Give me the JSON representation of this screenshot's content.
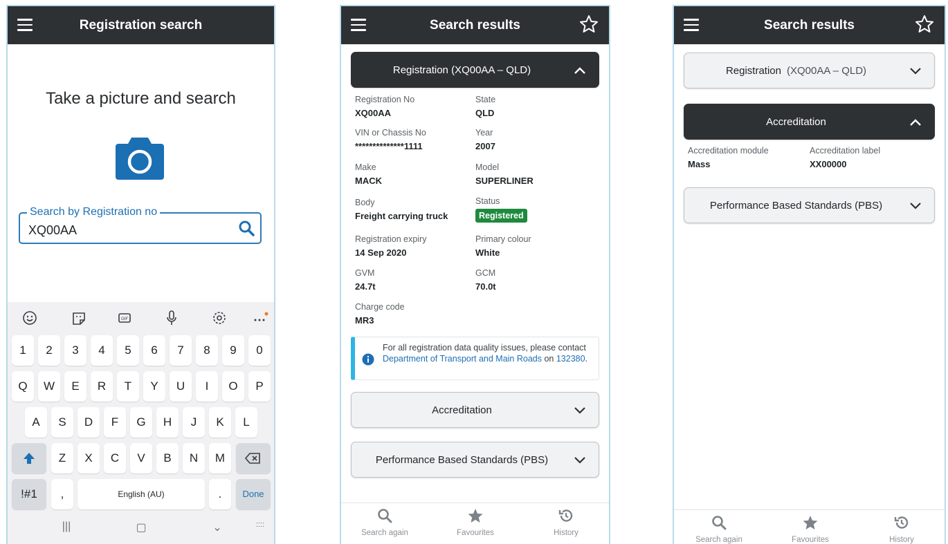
{
  "screen1": {
    "title": "Registration search",
    "heading": "Take a picture and search",
    "search": {
      "label": "Search by Registration no",
      "value": "XQ00AA"
    },
    "keyboard": {
      "row1": [
        "1",
        "2",
        "3",
        "4",
        "5",
        "6",
        "7",
        "8",
        "9",
        "0"
      ],
      "row2": [
        "Q",
        "W",
        "E",
        "R",
        "T",
        "Y",
        "U",
        "I",
        "O",
        "P"
      ],
      "row3": [
        "A",
        "S",
        "D",
        "F",
        "G",
        "H",
        "J",
        "K",
        "L"
      ],
      "row4": [
        "Z",
        "X",
        "C",
        "V",
        "B",
        "N",
        "M"
      ],
      "symbols": "!#1",
      "comma": ",",
      "space": "English (AU)",
      "period": ".",
      "done": "Done"
    }
  },
  "screen2": {
    "title": "Search results",
    "registration_header": "Registration (XQ00AA – QLD)",
    "fields": {
      "reg_no": {
        "label": "Registration No",
        "value": "XQ00AA"
      },
      "state": {
        "label": "State",
        "value": "QLD"
      },
      "vin": {
        "label": "VIN or Chassis No",
        "value": "**************1111"
      },
      "year": {
        "label": "Year",
        "value": "2007"
      },
      "make": {
        "label": "Make",
        "value": "MACK"
      },
      "model": {
        "label": "Model",
        "value": "SUPERLINER"
      },
      "body": {
        "label": "Body",
        "value": "Freight carrying truck"
      },
      "status": {
        "label": "Status",
        "value": "Registered"
      },
      "expiry": {
        "label": "Registration expiry",
        "value": "14 Sep 2020"
      },
      "colour": {
        "label": "Primary colour",
        "value": "White"
      },
      "gvm": {
        "label": "GVM",
        "value": "24.7t"
      },
      "gcm": {
        "label": "GCM",
        "value": "70.0t"
      },
      "charge": {
        "label": "Charge code",
        "value": "MR3"
      }
    },
    "notice": {
      "text_before": "For all registration data quality issues, please contact ",
      "link_dept": "Department of Transport and Main Roads",
      "text_mid": " on ",
      "link_phone": "132380",
      "text_end": "."
    },
    "accreditation": "Accreditation",
    "pbs": "Performance Based Standards (PBS)"
  },
  "screen3": {
    "title": "Search results",
    "registration_label": "Registration",
    "registration_sub": "(XQ00AA – QLD)",
    "accreditation": "Accreditation",
    "module": {
      "label": "Accreditation module",
      "value": "Mass"
    },
    "acc_label": {
      "label": "Accreditation label",
      "value": "XX00000"
    },
    "pbs": "Performance Based Standards (PBS)"
  },
  "nav": {
    "search": "Search again",
    "favourites": "Favourites",
    "history": "History"
  },
  "colors": {
    "appbar": "#2d3134",
    "accent": "#1d6fb4",
    "status_green": "#1e8a3e",
    "info": "#2fb4e6"
  }
}
